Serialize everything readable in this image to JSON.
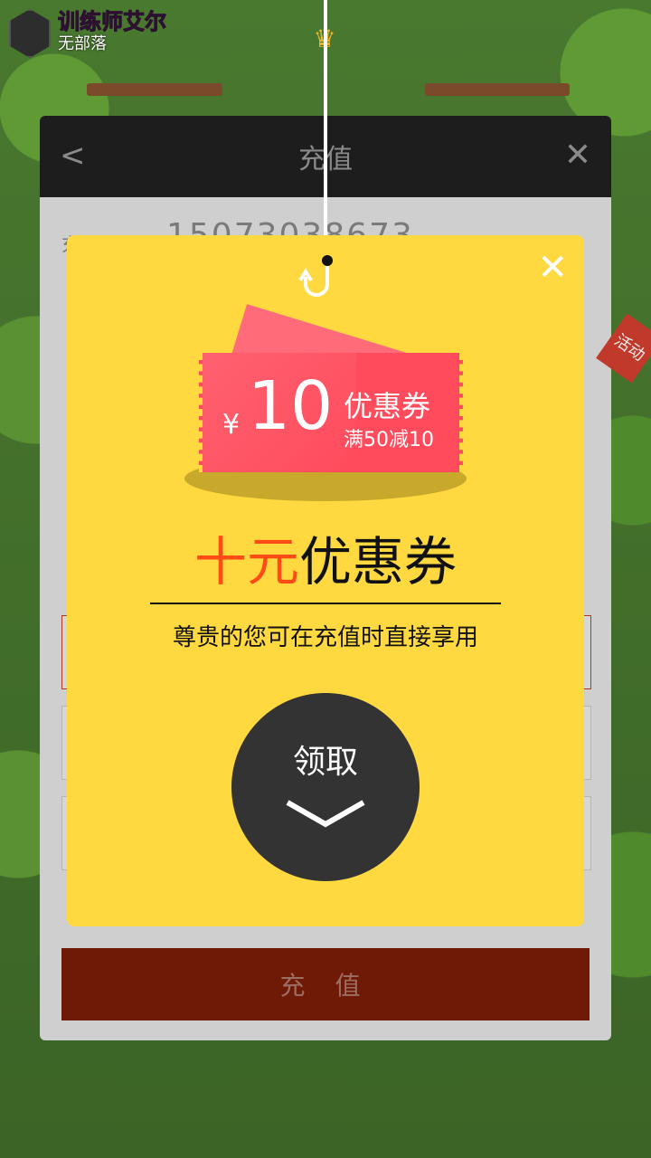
{
  "game": {
    "player_name": "训练师艾尔",
    "clan": "无部落",
    "crown_icon": "crown-icon"
  },
  "panel": {
    "title": "充值",
    "back_icon": "chevron-left-icon",
    "close_icon": "close-icon",
    "account_label": "充值账号",
    "account_value": "15073038673",
    "recharge_button": "充 值",
    "side_badge": "活动"
  },
  "coupon": {
    "close_icon": "close-icon",
    "hook_icon": "hook-icon",
    "currency": "¥",
    "amount": "10",
    "label": "优惠券",
    "rule": "满50减10",
    "headline_accent": "十元",
    "headline_rest": "优惠券",
    "subline": "尊贵的您可在充值时直接享用",
    "claim_label": "领取",
    "claim_icon": "chevron-down-icon"
  },
  "colors": {
    "modal_bg": "#ffd93f",
    "ticket": "#ff4b5c",
    "accent": "#ff4b16",
    "claim_bg": "#333333",
    "recharge_bg": "#6e1a06"
  }
}
